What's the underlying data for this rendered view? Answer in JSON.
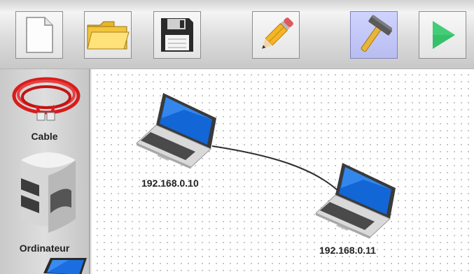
{
  "toolbar": {
    "buttons": [
      {
        "name": "new-document",
        "icon": "new-document-icon"
      },
      {
        "name": "open-folder",
        "icon": "folder-icon"
      },
      {
        "name": "save",
        "icon": "floppy-disk-icon"
      },
      {
        "name": "edit",
        "icon": "pencil-icon"
      },
      {
        "name": "build",
        "icon": "hammer-icon",
        "active": true
      },
      {
        "name": "run",
        "icon": "play-icon"
      }
    ],
    "active_color": "#c4c8f8",
    "play_color": "#35c06a"
  },
  "sidebar": {
    "items": [
      {
        "label": "Cable",
        "icon": "red-cable-icon"
      },
      {
        "label": "Ordinateur",
        "icon": "server-tower-icon"
      },
      {
        "label": "",
        "icon": "laptop-icon"
      }
    ]
  },
  "canvas": {
    "nodes": [
      {
        "label": "192.168.0.10",
        "icon": "laptop-icon"
      },
      {
        "label": "192.168.0.11",
        "icon": "laptop-icon"
      }
    ],
    "links": [
      {
        "from": "192.168.0.10",
        "to": "192.168.0.11"
      }
    ]
  }
}
